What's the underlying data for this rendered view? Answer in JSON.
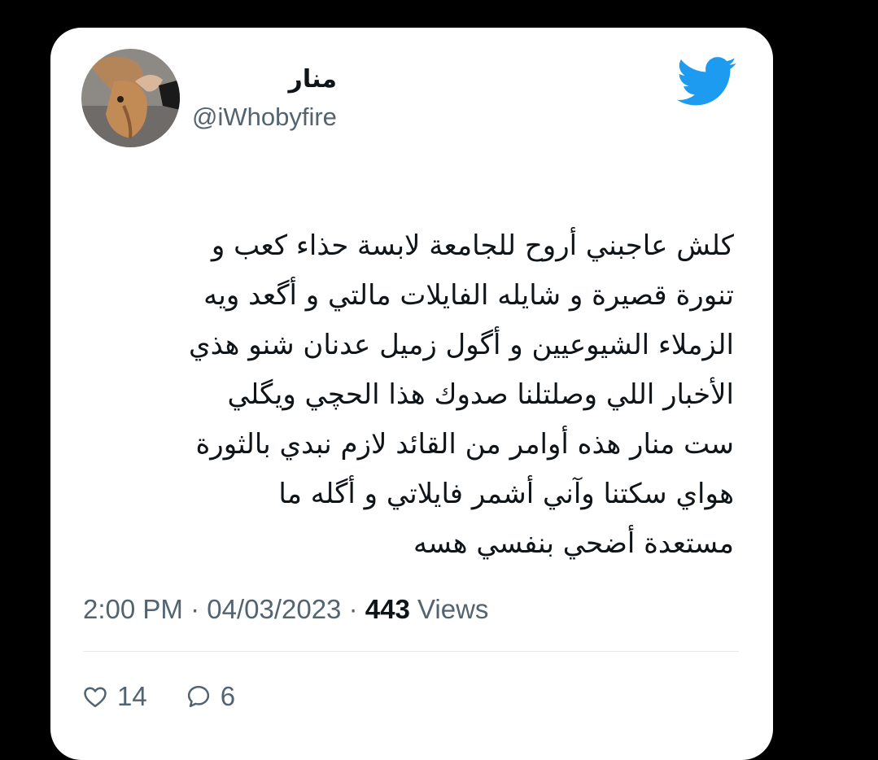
{
  "tweet": {
    "display_name": "منار",
    "handle": "@iWhobyfire",
    "text_lines": [
      "كلش عاجبني أروح للجامعة لابسة حذاء كعب و",
      "تنورة قصيرة و شايله الفايلات مالتي و أگعد ويه",
      "الزملاء الشيوعيين و أگول زميل عدنان شنو هذي",
      "الأخبار اللي وصلتلنا صدوك هذا الحچي ويگلي",
      "ست منار هذه أوامر من القائد لازم نبدي بالثورة",
      "هواي سكتنا وآني أشمر فايلاتي و أگله ما",
      "مستعدة أضحي بنفسي هسه"
    ],
    "time": "2:00 PM",
    "date": "04/03/2023",
    "separator": "·",
    "views_count": "443",
    "views_label": "Views",
    "likes": "14",
    "replies": "6"
  },
  "icons": {
    "logo": "twitter-bird-icon",
    "like": "heart-icon",
    "reply": "speech-bubble-icon"
  },
  "colors": {
    "brand_blue": "#1d9bf0",
    "text_primary": "#0f1419",
    "text_secondary": "#536471",
    "background": "#000000",
    "card": "#ffffff"
  }
}
